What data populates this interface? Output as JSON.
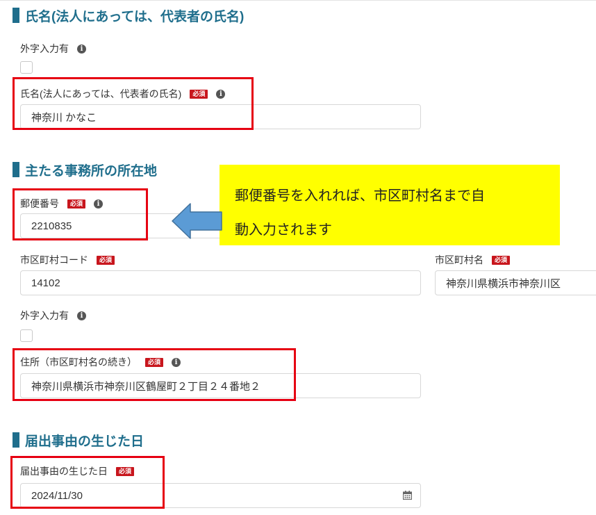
{
  "colors": {
    "accent": "#1f6e8c",
    "highlight_red": "#e60012",
    "required_badge": "#c8161d",
    "info_icon": "#555555",
    "callout_bg": "#ffff00",
    "arrow_fill": "#5b9bd5",
    "arrow_stroke": "#41719c"
  },
  "icons": {
    "info": "info-circle-icon",
    "calendar": "calendar-icon",
    "arrow": "left-arrow-icon"
  },
  "section1": {
    "title": "氏名(法人にあっては、代表者の氏名)",
    "gaiji_label": "外字入力有",
    "name_label": "氏名(法人にあっては、代表者の氏名)",
    "required": "必須",
    "name_value": "神奈川 かなこ"
  },
  "section2": {
    "title": "主たる事務所の所在地",
    "postal_label": "郵便番号",
    "required": "必須",
    "postal_value": "2210835",
    "city_code_label": "市区町村コード",
    "city_code_value": "14102",
    "city_name_label": "市区町村名",
    "city_name_value": "神奈川県横浜市神奈川区",
    "gaiji_label": "外字入力有",
    "address_label": "住所（市区町村名の続き）",
    "address_value": "神奈川県横浜市神奈川区鶴屋町２丁目２４番地２"
  },
  "section3": {
    "title": "届出事由の生じた日",
    "date_label": "届出事由の生じた日",
    "required": "必須",
    "date_value": "2024/11/30"
  },
  "callout": {
    "line1": "郵便番号を入れれば、市区町村名まで自",
    "line2": "動入力されます"
  }
}
